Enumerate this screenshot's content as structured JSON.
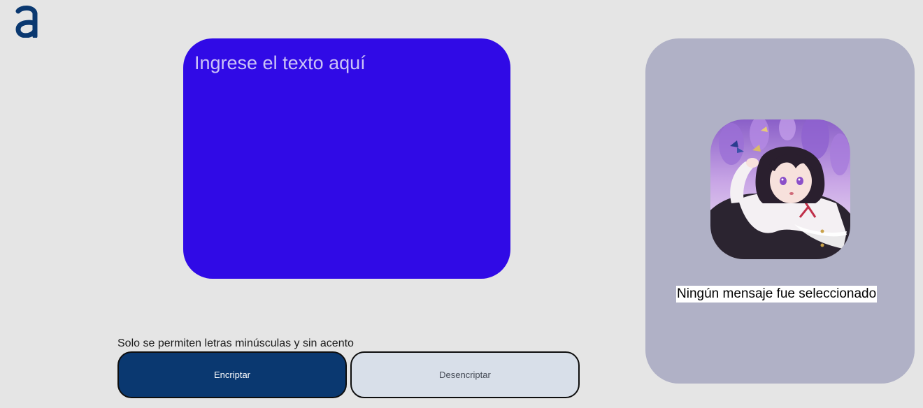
{
  "header": {
    "logo_icon": "alura-a-logo-icon"
  },
  "input": {
    "placeholder": "Ingrese el texto aquí",
    "value": ""
  },
  "hint": {
    "text": "Solo se permiten letras minúsculas y sin acento"
  },
  "actions": {
    "encrypt_label": "Encriptar",
    "decrypt_label": "Desencriptar"
  },
  "output": {
    "illustration_icon": "anime-character-illustration",
    "empty_message": "Ningún mensaje fue seleccionado"
  },
  "colors": {
    "page_background": "#e5e5e5",
    "input_card": "#300ae6",
    "output_card": "#b0b1c6",
    "encrypt_button": "#0a3870",
    "decrypt_button": "#d8dfe9",
    "logo": "#0a3870"
  }
}
